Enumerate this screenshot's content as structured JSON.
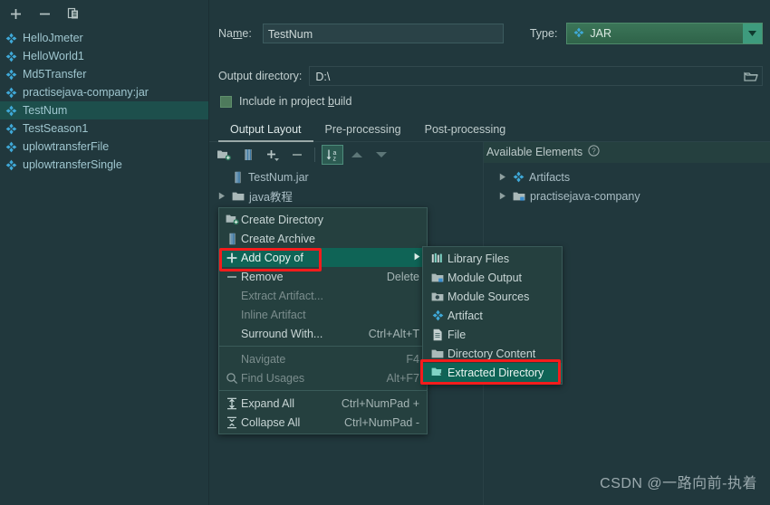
{
  "colors": {
    "background": "#21383d",
    "panel": "#25403f",
    "selection": "#1d4f4c",
    "menu_highlight": "#0f6456",
    "annotation_red": "#f41c1c",
    "combo_green": "#3b7558",
    "accent_text": "#9fc6cf"
  },
  "left_panel": {
    "toolbar": [
      {
        "name": "add-artifact-button",
        "icon": "plus-icon",
        "label": "+"
      },
      {
        "name": "remove-artifact-button",
        "icon": "minus-icon",
        "label": "−"
      },
      {
        "name": "copy-artifact-button",
        "icon": "copy-icon",
        "label": "Copy"
      }
    ],
    "artifacts": [
      {
        "label": "HelloJmeter",
        "icon": "artifact-icon",
        "selected": false
      },
      {
        "label": "HelloWorld1",
        "icon": "artifact-icon",
        "selected": false
      },
      {
        "label": "Md5Transfer",
        "icon": "artifact-icon",
        "selected": false
      },
      {
        "label": "practisejava-company:jar",
        "icon": "artifact-icon",
        "selected": false
      },
      {
        "label": "TestNum",
        "icon": "artifact-icon",
        "selected": true
      },
      {
        "label": "TestSeason1",
        "icon": "artifact-icon",
        "selected": false
      },
      {
        "label": "uplowtransferFile",
        "icon": "artifact-icon",
        "selected": false
      },
      {
        "label": "uplowtransferSingle",
        "icon": "artifact-icon",
        "selected": false
      }
    ]
  },
  "form": {
    "name_label": "Name:",
    "name_value": "TestNum",
    "type_label": "Type:",
    "type_value": "JAR",
    "type_icon": "artifact-icon",
    "output_dir_label": "Output directory:",
    "output_dir_value": "D:\\",
    "browse_icon": "folder-open-icon",
    "include_label": "Include in project build",
    "include_checked": true
  },
  "tabs": [
    {
      "label": "Output Layout",
      "active": true
    },
    {
      "label": "Pre-processing",
      "active": false
    },
    {
      "label": "Post-processing",
      "active": false
    }
  ],
  "layout_toolbar": [
    {
      "name": "create-directory-button",
      "icon": "folder-add-icon",
      "pressed": false
    },
    {
      "name": "create-archive-button",
      "icon": "archive-icon",
      "pressed": false
    },
    {
      "name": "add-copy-of-button",
      "icon": "plus-dropdown-icon",
      "pressed": false
    },
    {
      "name": "remove-button",
      "icon": "minus-icon",
      "pressed": false
    },
    {
      "name": "sort-button",
      "icon": "sort-az-icon",
      "pressed": true
    },
    {
      "name": "move-up-button",
      "icon": "arrow-up-icon",
      "pressed": false
    },
    {
      "name": "move-down-button",
      "icon": "arrow-down-icon",
      "pressed": false
    }
  ],
  "output_tree": [
    {
      "label": "TestNum.jar",
      "icon": "archive-icon",
      "twisty": false
    },
    {
      "label": "java教程",
      "icon": "folder-icon",
      "twisty": true
    }
  ],
  "available": {
    "header": "Available Elements",
    "help_icon": "help-icon",
    "items": [
      {
        "label": "Artifacts",
        "icon": "artifact-icon",
        "twisty": true
      },
      {
        "label": "practisejava-company",
        "icon": "module-output-icon",
        "twisty": true
      }
    ]
  },
  "context_menu": [
    {
      "label": "Create Directory",
      "icon": "folder-add-icon",
      "accel": "",
      "state": "normal",
      "submenu": false
    },
    {
      "label": "Create Archive",
      "icon": "archive-icon",
      "accel": "",
      "state": "normal",
      "submenu": false
    },
    {
      "label": "Add Copy of",
      "icon": "plus-icon",
      "accel": "",
      "state": "highlight",
      "submenu": true
    },
    {
      "label": "Remove",
      "icon": "minus-icon",
      "accel": "Delete",
      "state": "normal",
      "submenu": false
    },
    {
      "label": "Extract Artifact...",
      "icon": "",
      "accel": "",
      "state": "disabled",
      "submenu": false
    },
    {
      "label": "Inline Artifact",
      "icon": "",
      "accel": "",
      "state": "disabled",
      "submenu": false
    },
    {
      "label": "Surround With...",
      "icon": "",
      "accel": "Ctrl+Alt+T",
      "state": "normal",
      "submenu": false
    },
    {
      "separator": true
    },
    {
      "label": "Navigate",
      "icon": "",
      "accel": "F4",
      "state": "disabled",
      "submenu": false
    },
    {
      "label": "Find Usages",
      "icon": "search-icon",
      "accel": "Alt+F7",
      "state": "disabled",
      "submenu": false
    },
    {
      "separator": true
    },
    {
      "label": "Expand All",
      "icon": "expand-all-icon",
      "accel": "Ctrl+NumPad +",
      "state": "normal",
      "submenu": false
    },
    {
      "label": "Collapse All",
      "icon": "collapse-all-icon",
      "accel": "Ctrl+NumPad -",
      "state": "normal",
      "submenu": false
    }
  ],
  "submenu": [
    {
      "label": "Library Files",
      "icon": "library-files-icon",
      "state": "normal"
    },
    {
      "label": "Module Output",
      "icon": "module-output-icon",
      "state": "normal"
    },
    {
      "label": "Module Sources",
      "icon": "module-sources-icon",
      "state": "normal"
    },
    {
      "label": "Artifact",
      "icon": "artifact-icon",
      "state": "normal"
    },
    {
      "label": "File",
      "icon": "file-icon",
      "state": "normal"
    },
    {
      "label": "Directory Content",
      "icon": "folder-icon",
      "state": "normal"
    },
    {
      "label": "Extracted Directory",
      "icon": "extracted-directory-icon",
      "state": "highlight"
    }
  ],
  "annotations": [
    {
      "name": "add-copy-of-highlight-box",
      "color": "#f41c1c"
    },
    {
      "name": "extracted-directory-highlight-box",
      "color": "#f41c1c"
    }
  ],
  "watermark": "CSDN @一路向前-执着"
}
